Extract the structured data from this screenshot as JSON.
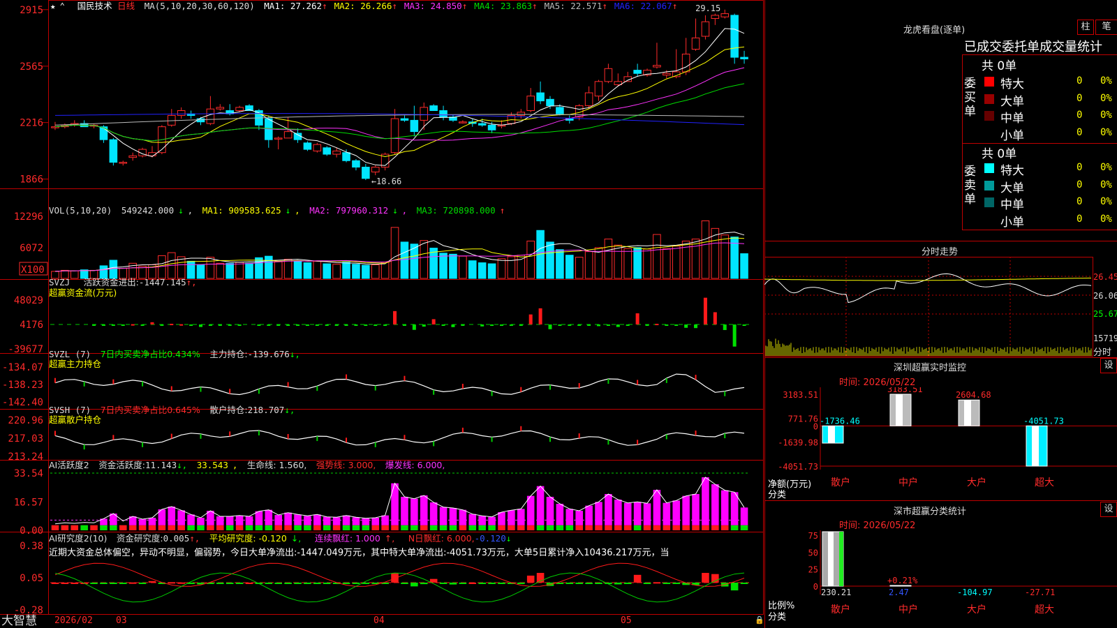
{
  "app": {
    "brand": "大智慧"
  },
  "colors": {
    "up": "#ff2b2b",
    "down": "#00e5ff",
    "grid": "#c00000",
    "ma1": "#ffffff",
    "ma2": "#ffff00",
    "ma3": "#ff33ff",
    "ma4": "#00dd00",
    "ma5": "#bbbbbb",
    "ma6": "#2222ff"
  },
  "kline": {
    "stock_name": "国民技术",
    "period": "日线",
    "ma_label": "MA(5,10,20,30,60,120)",
    "ma_values": [
      {
        "label": "MA1:",
        "value": "27.262"
      },
      {
        "label": "MA2:",
        "value": "26.266"
      },
      {
        "label": "MA3:",
        "value": "24.850"
      },
      {
        "label": "MA4:",
        "value": "23.863"
      },
      {
        "label": "MA5:",
        "value": "22.571"
      },
      {
        "label": "MA6:",
        "value": "22.067"
      }
    ],
    "y_ticks": [
      "2915",
      "2565",
      "2216",
      "1866"
    ],
    "high_label": "29.15",
    "low_label": "←18.66"
  },
  "vol": {
    "label": "VOL(5,10,20)",
    "value": "549242.000",
    "ma1": "909583.625",
    "ma2": "797960.312",
    "ma3": "720898.000",
    "y_ticks": [
      "12296",
      "6072"
    ],
    "unit": "X100"
  },
  "svzj": {
    "label": "SVZJ",
    "name": "活跃资金进出:",
    "value": "-1447.145",
    "subtitle": "超赢资金流(万元)",
    "y_ticks": [
      "48029",
      "4176",
      "-39677"
    ]
  },
  "svzl": {
    "label": "SVZL (7)",
    "desc": "7日内买卖净占比0.434%",
    "name": "主力持仓:",
    "value": "-139.676",
    "subtitle": "超赢主力持仓",
    "y_ticks": [
      "-134.07",
      "-138.23",
      "-142.40"
    ]
  },
  "svsh": {
    "label": "SVSH (7)",
    "desc": "7日内买卖净占比0.645%",
    "name": "散户持仓:",
    "value": "218.707",
    "subtitle": "超赢散户持仓",
    "y_ticks": [
      "220.96",
      "217.03",
      "213.24"
    ]
  },
  "ai_active": {
    "label": "AI活跃度2",
    "name": "资金活跃度:",
    "value": "11.143",
    "v2": "33.543",
    "life": "生命线: 1.560,",
    "strong": "强势线: 3.000,",
    "burst": "爆发线: 6.000,",
    "y_ticks": [
      "33.54",
      "16.57",
      "0.00"
    ]
  },
  "ai_research": {
    "label": "AI研究度2(10)",
    "name": "资金研究度:",
    "value": "0.005",
    "avg": "平均研究度: -0.120",
    "red": "连续飘红: 1.000",
    "nred": "N日飘红: 6.000,",
    "last": "-0.120",
    "comment": "近期大资金总体偏空，异动不明显，偏弱势，今日大单净流出:-1447.049万元，其中特大单净流出:-4051.73万元，大单5日累计净入10436.217万元，当",
    "y_ticks": [
      "0.38",
      "0.05",
      "-0.28"
    ]
  },
  "x_axis": {
    "labels": [
      "2026/02",
      "03",
      "04",
      "05"
    ]
  },
  "right": {
    "lhb_title": "龙虎看盘(逐单)",
    "btn_bar": "柱",
    "btn_pen": "笔",
    "tabs": "已成交委托单成交量统计",
    "buy": {
      "total": "共 0单",
      "side": "委买单",
      "rows": [
        {
          "name": "特大",
          "v": "0",
          "p": "0%",
          "c": "#ff0000"
        },
        {
          "name": "大单",
          "v": "0",
          "p": "0%",
          "c": "#990000"
        },
        {
          "name": "中单",
          "v": "0",
          "p": "0%",
          "c": "#660000"
        },
        {
          "name": "小单",
          "v": "0",
          "p": "0%",
          "c": ""
        }
      ]
    },
    "sell": {
      "total": "共 0单",
      "side": "委卖单",
      "rows": [
        {
          "name": "特大",
          "v": "0",
          "p": "0%",
          "c": "#00ffff"
        },
        {
          "name": "大单",
          "v": "0",
          "p": "0%",
          "c": "#009999"
        },
        {
          "name": "中单",
          "v": "0",
          "p": "0%",
          "c": "#006666"
        },
        {
          "name": "小单",
          "v": "0",
          "p": "0%",
          "c": ""
        }
      ]
    },
    "intraday": {
      "title": "分时走势",
      "y1": "26.45",
      "y2": "26.06",
      "y3": "25.67",
      "vol": "15719",
      "unit": "分时"
    },
    "sz_monitor": {
      "title": "深圳超赢实时监控",
      "btn": "设",
      "time": "时间: 2026/05/22",
      "y_ticks": [
        "3183.51",
        "771.76",
        "0",
        "-1639.98",
        "-4051.73"
      ],
      "y_label": "净额(万元)",
      "x_label": "分类",
      "cats": [
        "散户",
        "中户",
        "大户",
        "超大"
      ],
      "values": [
        -1736.46,
        3183.51,
        2604.68,
        -4051.73
      ],
      "value_labels": [
        "-1736.46",
        "3183.51",
        "2604.68",
        "-4051.73"
      ]
    },
    "sz_class": {
      "title": "深市超赢分类统计",
      "btn": "设",
      "time": "时间: 2026/05/22",
      "y_ticks": [
        "75",
        "50",
        "25",
        "0"
      ],
      "y_label": "比例%",
      "x_label": "分类",
      "cats": [
        "散户",
        "中户",
        "大户",
        "超大"
      ],
      "values": [
        "230.21",
        "2.47",
        "-104.97",
        "-27.71"
      ],
      "bar_pct": [
        100,
        0.21,
        0,
        0
      ],
      "mid_label": "+0.21%"
    }
  },
  "chart_data": [
    {
      "type": "candlestick",
      "title": "国民技术 日线",
      "ylim": [
        18.3,
        29.4
      ],
      "y_ticks": [
        29.15,
        25.65,
        22.16,
        18.66
      ],
      "ohlc": [
        [
          21.9,
          22.2,
          21.7,
          21.9
        ],
        [
          21.9,
          22.1,
          21.8,
          22.0
        ],
        [
          22.0,
          22.3,
          21.9,
          22.1
        ],
        [
          22.1,
          22.3,
          21.9,
          21.9
        ],
        [
          22.0,
          22.1,
          21.8,
          22.0
        ],
        [
          21.9,
          22.0,
          20.9,
          21.1
        ],
        [
          21.1,
          21.2,
          19.5,
          19.7
        ],
        [
          19.7,
          19.8,
          19.5,
          19.7
        ],
        [
          20.0,
          20.3,
          19.8,
          20.1
        ],
        [
          20.1,
          20.6,
          20.0,
          20.5
        ],
        [
          20.1,
          20.7,
          20.0,
          20.3
        ],
        [
          20.3,
          22.0,
          20.2,
          21.9
        ],
        [
          22.0,
          23.0,
          21.9,
          22.6
        ],
        [
          22.6,
          23.1,
          22.4,
          22.9
        ],
        [
          22.7,
          22.9,
          22.4,
          22.6
        ],
        [
          22.4,
          22.5,
          22.0,
          22.2
        ],
        [
          22.1,
          23.8,
          22.0,
          23.0
        ],
        [
          23.0,
          23.3,
          22.9,
          23.1
        ],
        [
          22.9,
          23.3,
          22.6,
          22.7
        ],
        [
          22.9,
          23.2,
          22.8,
          23.1
        ],
        [
          23.2,
          23.3,
          23.0,
          22.9
        ],
        [
          22.9,
          23.0,
          21.7,
          22.0
        ],
        [
          22.4,
          22.6,
          20.6,
          21.1
        ],
        [
          21.2,
          21.3,
          20.5,
          21.2
        ],
        [
          21.2,
          22.5,
          21.2,
          21.6
        ],
        [
          21.5,
          21.8,
          20.9,
          21.1
        ],
        [
          20.9,
          21.0,
          20.4,
          20.5
        ],
        [
          20.4,
          20.9,
          20.3,
          20.8
        ],
        [
          20.6,
          20.7,
          20.1,
          20.2
        ],
        [
          20.2,
          20.6,
          20.0,
          20.4
        ],
        [
          20.3,
          20.5,
          19.7,
          19.8
        ],
        [
          19.8,
          19.9,
          19.2,
          19.4
        ],
        [
          19.4,
          19.6,
          18.6,
          18.7
        ],
        [
          19.1,
          19.5,
          18.9,
          19.4
        ],
        [
          19.4,
          20.3,
          19.2,
          20.2
        ],
        [
          20.3,
          23.0,
          20.2,
          22.4
        ],
        [
          22.4,
          22.6,
          22.2,
          22.3
        ],
        [
          22.3,
          23.2,
          21.3,
          21.6
        ],
        [
          22.3,
          23.4,
          21.7,
          23.1
        ],
        [
          23.2,
          23.3,
          23.0,
          22.9
        ],
        [
          22.9,
          23.2,
          22.3,
          22.5
        ],
        [
          22.5,
          22.6,
          22.2,
          22.3
        ],
        [
          22.2,
          22.3,
          22.1,
          22.2
        ],
        [
          22.2,
          22.4,
          21.9,
          22.1
        ],
        [
          22.1,
          22.4,
          21.9,
          22.0
        ],
        [
          22.0,
          22.2,
          21.5,
          21.7
        ],
        [
          22.0,
          22.3,
          21.8,
          22.0
        ],
        [
          22.1,
          22.8,
          22.0,
          22.6
        ],
        [
          22.6,
          23.0,
          22.4,
          22.8
        ],
        [
          22.9,
          24.3,
          22.8,
          23.8
        ],
        [
          24.0,
          24.7,
          23.3,
          23.5
        ],
        [
          23.6,
          23.8,
          23.0,
          23.2
        ],
        [
          23.1,
          23.3,
          22.6,
          22.7
        ],
        [
          22.4,
          22.6,
          22.1,
          22.3
        ],
        [
          22.5,
          23.3,
          22.3,
          23.2
        ],
        [
          23.2,
          24.4,
          23.0,
          24.0
        ],
        [
          23.8,
          24.8,
          23.5,
          24.7
        ],
        [
          24.7,
          25.8,
          24.6,
          25.5
        ],
        [
          24.5,
          25.2,
          24.4,
          24.7
        ],
        [
          24.7,
          25.3,
          24.7,
          25.0
        ],
        [
          25.4,
          25.8,
          25.0,
          25.2
        ],
        [
          25.1,
          25.5,
          25.0,
          25.4
        ],
        [
          25.6,
          27.1,
          25.5,
          25.7
        ],
        [
          25.1,
          25.4,
          24.9,
          25.2
        ],
        [
          25.0,
          26.7,
          24.9,
          25.3
        ],
        [
          25.3,
          27.4,
          25.1,
          26.4
        ],
        [
          26.7,
          28.6,
          26.6,
          27.4
        ],
        [
          27.5,
          28.8,
          27.3,
          28.4
        ],
        [
          28.6,
          28.9,
          28.2,
          28.8
        ],
        [
          28.7,
          29.15,
          28.6,
          28.9
        ],
        [
          28.8,
          28.9,
          25.8,
          26.2
        ],
        [
          26.2,
          26.6,
          25.8,
          26.1
        ]
      ],
      "ma": {
        "MA1": 27.262,
        "MA2": 26.266,
        "MA3": 24.85,
        "MA4": 23.863,
        "MA5": 22.571,
        "MA6": 22.067
      }
    },
    {
      "type": "bar",
      "title": "VOL(5,10,20)",
      "ylim": [
        0,
        12296
      ],
      "values": [
        1400,
        1600,
        1500,
        1700,
        1600,
        2500,
        3600,
        2000,
        3000,
        2400,
        2700,
        4500,
        5100,
        4300,
        3400,
        2700,
        4200,
        3000,
        3000,
        3200,
        3000,
        4100,
        4400,
        3300,
        3800,
        3400,
        3100,
        3400,
        2900,
        2800,
        3200,
        2800,
        2600,
        2700,
        3200,
        10100,
        7200,
        6800,
        7500,
        6000,
        5000,
        4800,
        4400,
        3500,
        3100,
        2900,
        3900,
        4300,
        4600,
        7400,
        9500,
        7200,
        5700,
        4600,
        4200,
        5300,
        6100,
        7800,
        6600,
        5900,
        6100,
        5800,
        8700,
        5900,
        6400,
        7400,
        7800,
        11400,
        9900,
        8600,
        8200,
        4900
      ]
    },
    {
      "type": "bar",
      "title": "超赢资金流(万元)",
      "ylim": [
        -39677,
        48029
      ],
      "values": [
        0,
        0,
        0,
        0,
        -500,
        -400,
        -1000,
        -1500,
        500,
        -1100,
        4000,
        -700,
        1200,
        400,
        -2500,
        -4500,
        -2500,
        -1500,
        -500,
        -1500,
        0,
        -1500,
        -2200,
        -700,
        -600,
        -1200,
        -1500,
        -1200,
        -2200,
        -700,
        -1200,
        -600,
        -1500,
        -700,
        -1200,
        24000,
        -1100,
        -9700,
        -3900,
        9500,
        -2300,
        -4800,
        -1100,
        0,
        -3500,
        -1200,
        -2500,
        -1800,
        -2300,
        18000,
        29000,
        -8500,
        -1500,
        -1300,
        -1300,
        -700,
        -3000,
        -800,
        -4500,
        -1500,
        20000,
        -1700,
        1200,
        -1500,
        -1900,
        -6000,
        -6500,
        48029,
        22000,
        -10000,
        -39677,
        -1500
      ]
    },
    {
      "type": "line",
      "title": "超赢主力持仓",
      "ylim": [
        -142.4,
        -134.07
      ]
    },
    {
      "type": "line",
      "title": "超赢散户持仓",
      "ylim": [
        213.24,
        220.96
      ]
    },
    {
      "type": "bar",
      "title": "AI活跃度2",
      "ylim": [
        0,
        33.54
      ]
    },
    {
      "type": "bar",
      "title": "AI研究度2(10)",
      "ylim": [
        -0.28,
        0.38
      ]
    },
    {
      "type": "bar",
      "title": "深圳超赢实时监控",
      "categories": [
        "散户",
        "中户",
        "大户",
        "超大"
      ],
      "values": [
        -1736.46,
        3183.51,
        2604.68,
        -4051.73
      ],
      "ylabel": "净额(万元)",
      "xlabel": "分类"
    },
    {
      "type": "bar",
      "title": "深市超赢分类统计",
      "categories": [
        "散户",
        "中户",
        "大户",
        "超大"
      ],
      "values": [
        230.21,
        2.47,
        -104.97,
        -27.71
      ],
      "ylabel": "比例%",
      "xlabel": "分类"
    }
  ]
}
